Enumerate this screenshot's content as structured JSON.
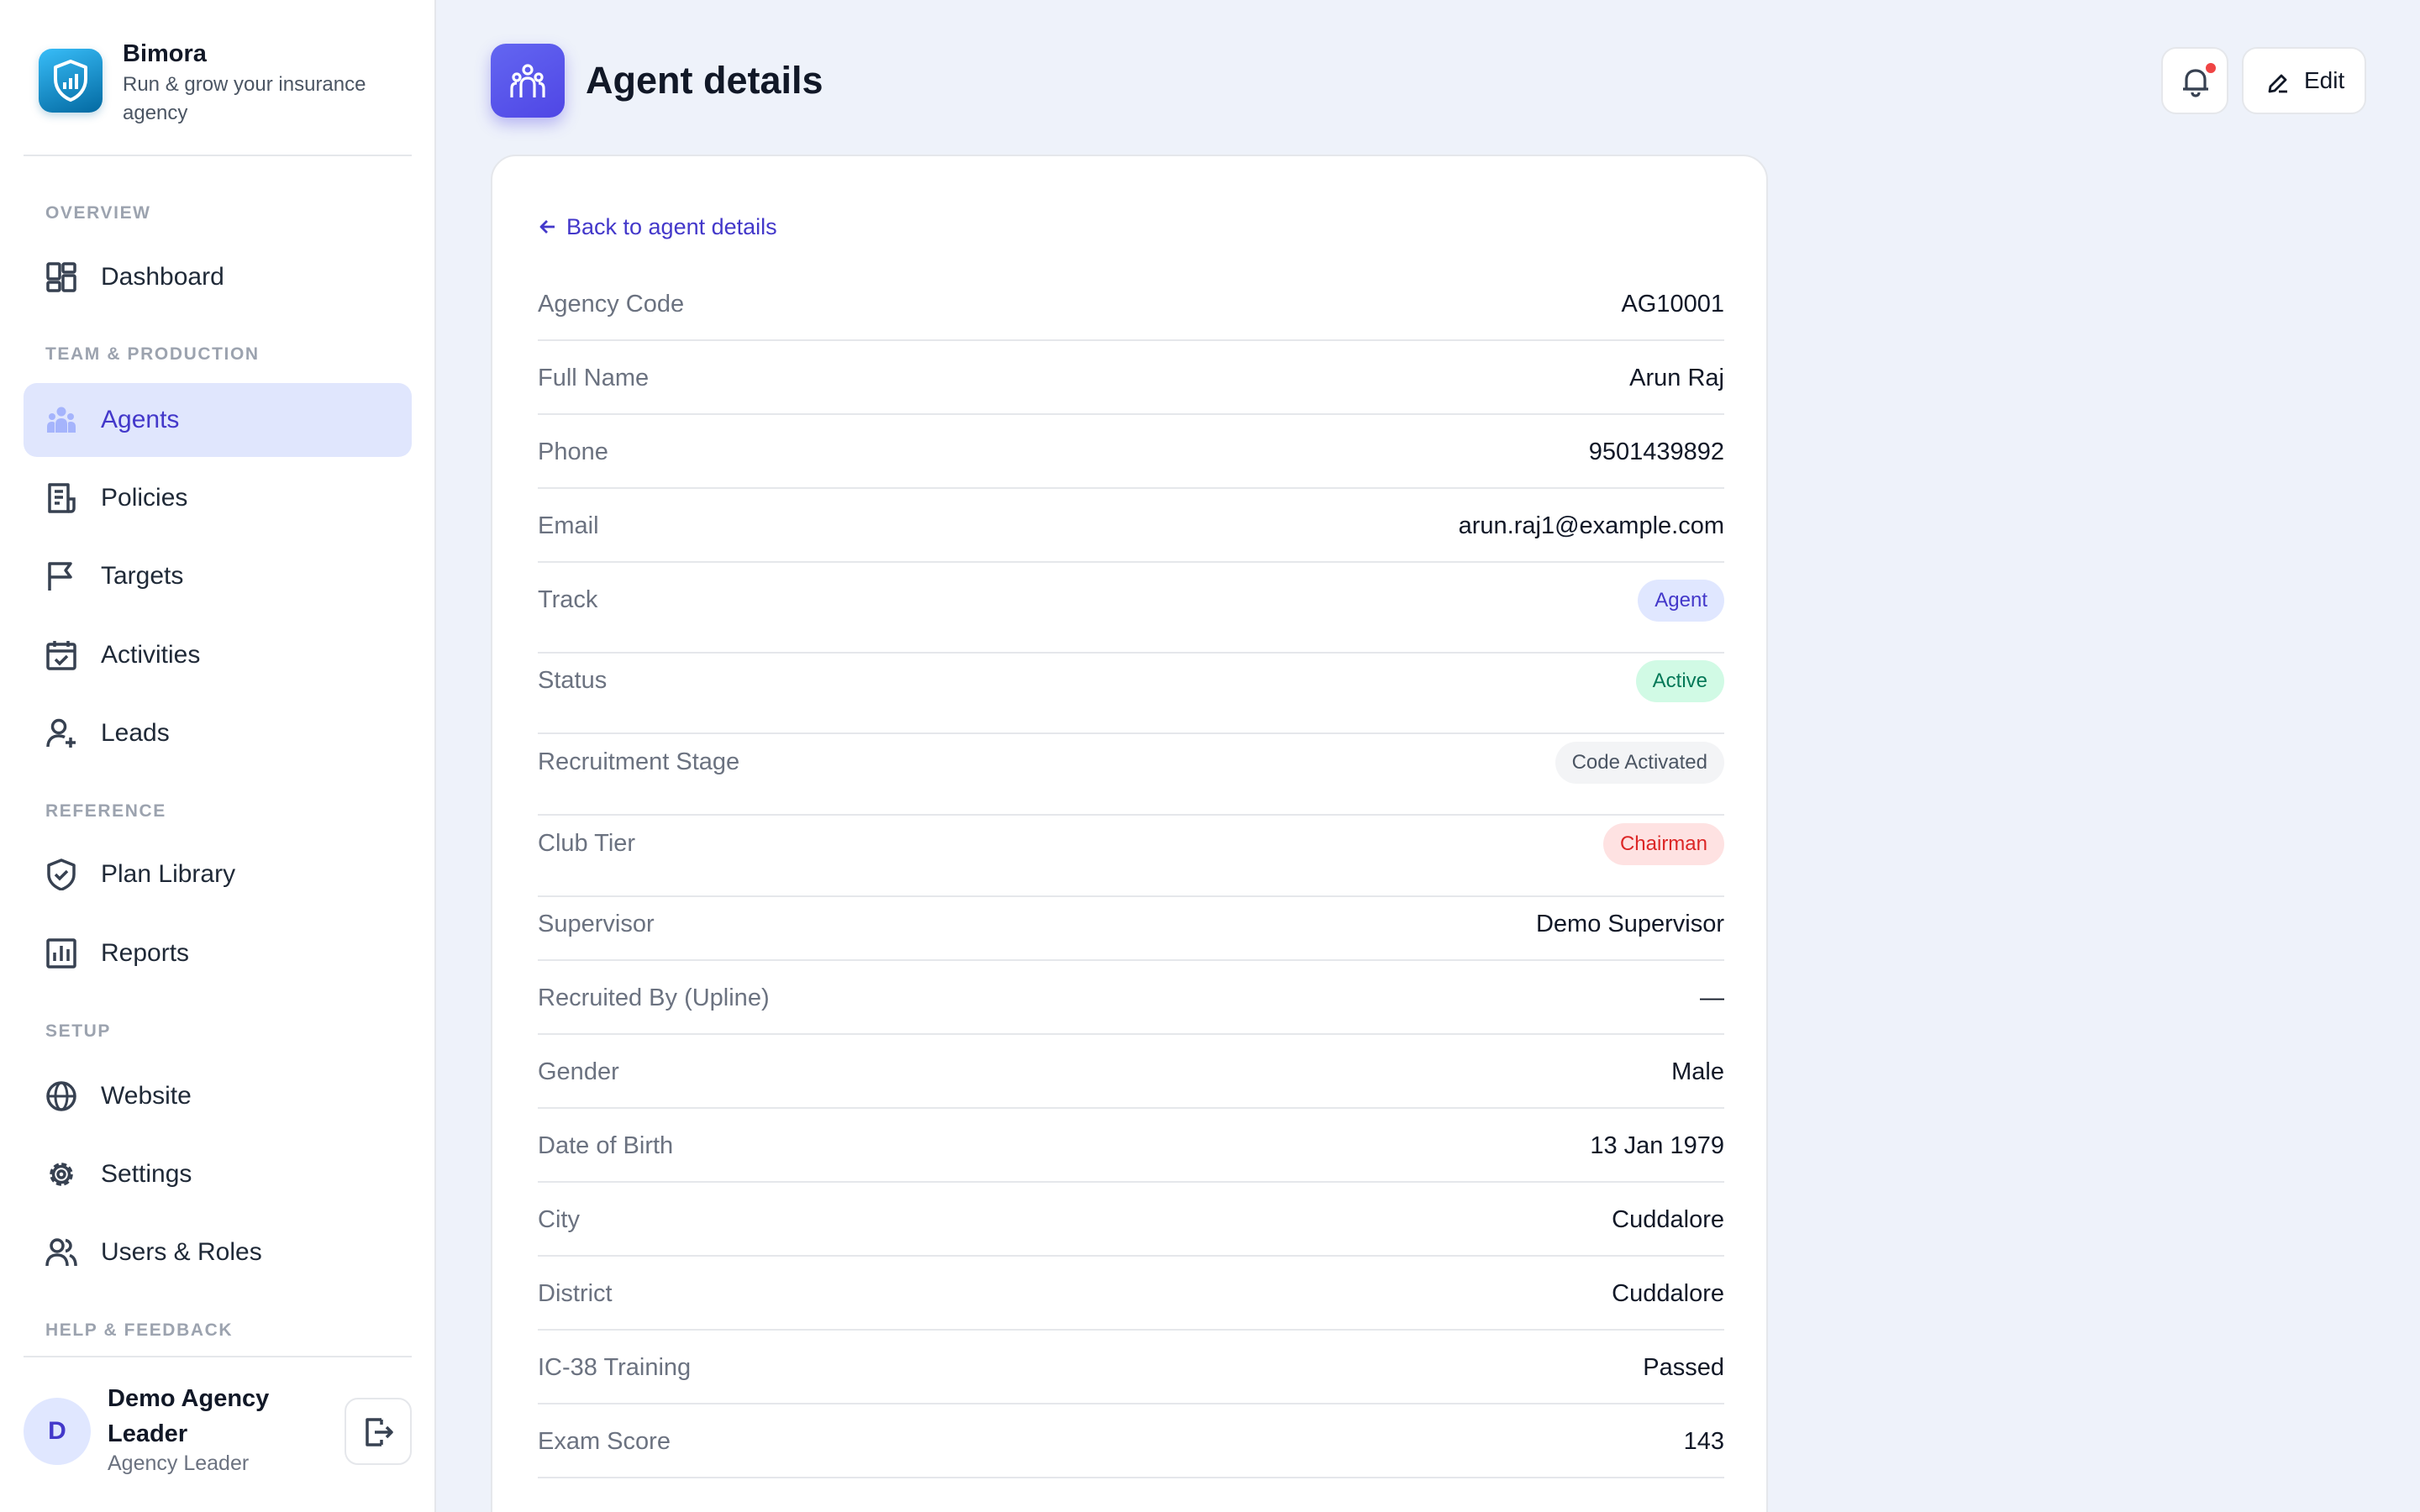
{
  "brand": {
    "name": "Bimora",
    "tagline": "Run & grow your insurance agency"
  },
  "nav": {
    "sections": {
      "overview": "OVERVIEW",
      "team": "TEAM & PRODUCTION",
      "reference": "REFERENCE",
      "setup": "SETUP",
      "help": "HELP & FEEDBACK"
    },
    "items": {
      "dashboard": "Dashboard",
      "agents": "Agents",
      "policies": "Policies",
      "targets": "Targets",
      "activities": "Activities",
      "leads": "Leads",
      "plan_library": "Plan Library",
      "reports": "Reports",
      "website": "Website",
      "settings": "Settings",
      "users_roles": "Users & Roles"
    },
    "active": "agents"
  },
  "user": {
    "initial": "D",
    "name": "Demo Agency Leader",
    "role": "Agency Leader"
  },
  "header": {
    "title": "Agent details",
    "edit_label": "Edit"
  },
  "card": {
    "back_label": "Back to agent details"
  },
  "details": {
    "agency_code": {
      "label": "Agency Code",
      "value": "AG10001"
    },
    "full_name": {
      "label": "Full Name",
      "value": "Arun Raj"
    },
    "phone": {
      "label": "Phone",
      "value": "9501439892"
    },
    "email": {
      "label": "Email",
      "value": "arun.raj1@example.com"
    },
    "track": {
      "label": "Track",
      "value": "Agent"
    },
    "status": {
      "label": "Status",
      "value": "Active"
    },
    "recruitment_stage": {
      "label": "Recruitment Stage",
      "value": "Code Activated"
    },
    "club_tier": {
      "label": "Club Tier",
      "value": "Chairman"
    },
    "supervisor": {
      "label": "Supervisor",
      "value": "Demo Supervisor"
    },
    "recruited_by": {
      "label": "Recruited By (Upline)",
      "value": "—"
    },
    "gender": {
      "label": "Gender",
      "value": "Male"
    },
    "dob": {
      "label": "Date of Birth",
      "value": "13 Jan 1979"
    },
    "city": {
      "label": "City",
      "value": "Cuddalore"
    },
    "district": {
      "label": "District",
      "value": "Cuddalore"
    },
    "ic38": {
      "label": "IC-38 Training",
      "value": "Passed"
    },
    "exam_score": {
      "label": "Exam Score",
      "value": "143"
    }
  },
  "colors": {
    "accent": "#4338ca",
    "active_nav_bg": "#e0e6fd",
    "page_bg": "#eef2fa",
    "badge_green": "#047857",
    "badge_red": "#dc2626",
    "notification_dot": "#ef4444"
  }
}
